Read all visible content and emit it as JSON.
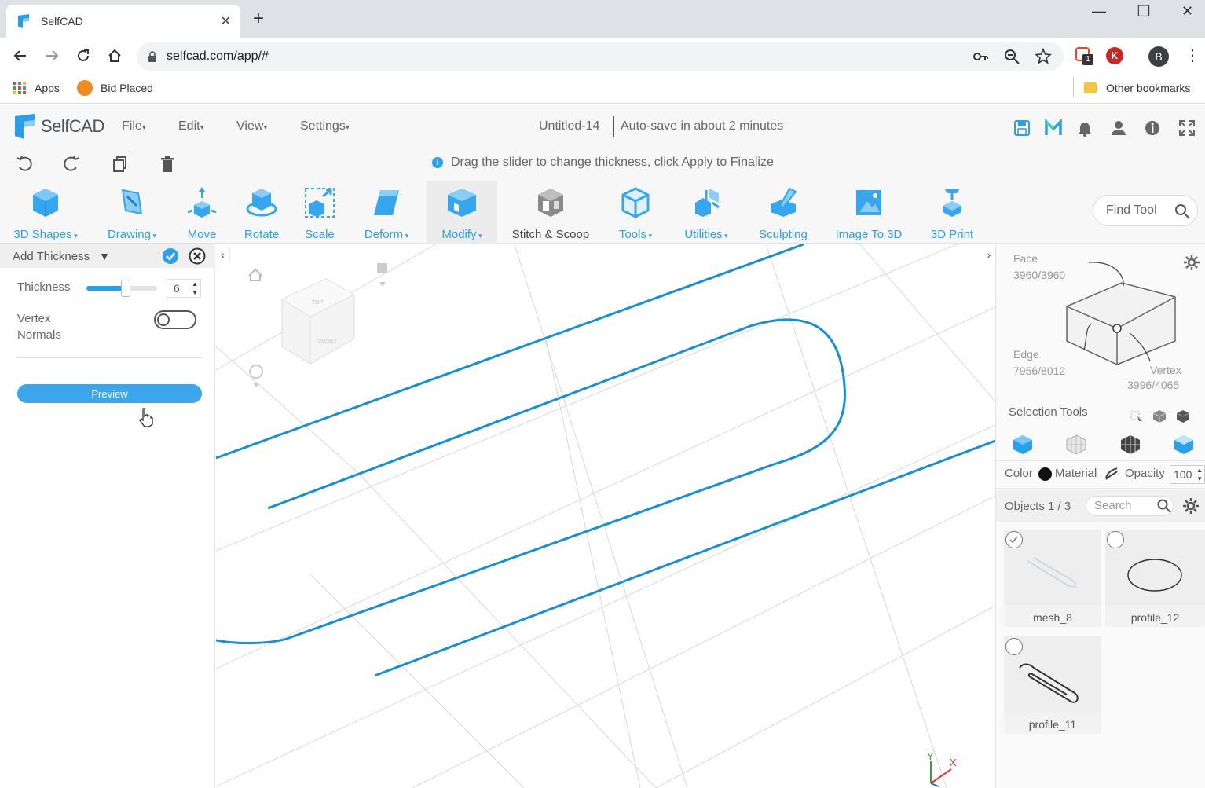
{
  "browser": {
    "tab_title": "SelfCAD",
    "url": "selfcad.com/app/#",
    "bookmarks": [
      "Apps",
      "Bid Placed"
    ],
    "other_bookmarks": "Other bookmarks",
    "profile_initial": "B",
    "ext_initial": "K",
    "ext_badge": "1"
  },
  "app": {
    "brand": "SelfCAD",
    "menus": [
      "File",
      "Edit",
      "View",
      "Settings"
    ],
    "doc_title": "Untitled-14",
    "autosave": "Auto-save in about 2 minutes",
    "hint": "Drag the slider to change thickness, click Apply to Finalize",
    "tools": [
      {
        "label": "3D Shapes",
        "dropdown": true
      },
      {
        "label": "Drawing",
        "dropdown": true
      },
      {
        "label": "Move",
        "dropdown": false
      },
      {
        "label": "Rotate",
        "dropdown": false
      },
      {
        "label": "Scale",
        "dropdown": false
      },
      {
        "label": "Deform",
        "dropdown": true
      },
      {
        "label": "Modify",
        "dropdown": true
      },
      {
        "label": "Stitch & Scoop",
        "dropdown": false
      },
      {
        "label": "Tools",
        "dropdown": true
      },
      {
        "label": "Utilities",
        "dropdown": true
      },
      {
        "label": "Sculpting",
        "dropdown": false
      },
      {
        "label": "Image To 3D",
        "dropdown": false
      },
      {
        "label": "3D Print",
        "dropdown": false
      }
    ],
    "find_tool_placeholder": "Find Tool",
    "accent": "#2aa0e8"
  },
  "left_panel": {
    "title": "Add Thickness",
    "thickness_label": "Thickness",
    "thickness_value": "6",
    "thickness_slider_fraction": 0.55,
    "vertex_normals_label_1": "Vertex",
    "vertex_normals_label_2": "Normals",
    "vertex_normals_on": false,
    "preview_button": "Preview"
  },
  "right_panel": {
    "face_label": "Face",
    "face_count": "3960/3960",
    "edge_label": "Edge",
    "edge_count": "7956/8012",
    "vertex_label": "Vertex",
    "vertex_count": "3996/4065",
    "selection_tools_label": "Selection Tools",
    "color_label": "Color",
    "material_label": "Material",
    "opacity_label": "Opacity",
    "opacity_value": "100",
    "objects_label": "Objects 1 / 3",
    "search_placeholder": "Search",
    "objects": [
      {
        "name": "mesh_8",
        "checked": true
      },
      {
        "name": "profile_12",
        "checked": false
      },
      {
        "name": "profile_11",
        "checked": false
      }
    ]
  },
  "viewport": {
    "axis_x": "X",
    "axis_y": "Y",
    "cube_top": "TOP",
    "cube_front": "FRONT",
    "curve_color": "#1a8fd0"
  }
}
